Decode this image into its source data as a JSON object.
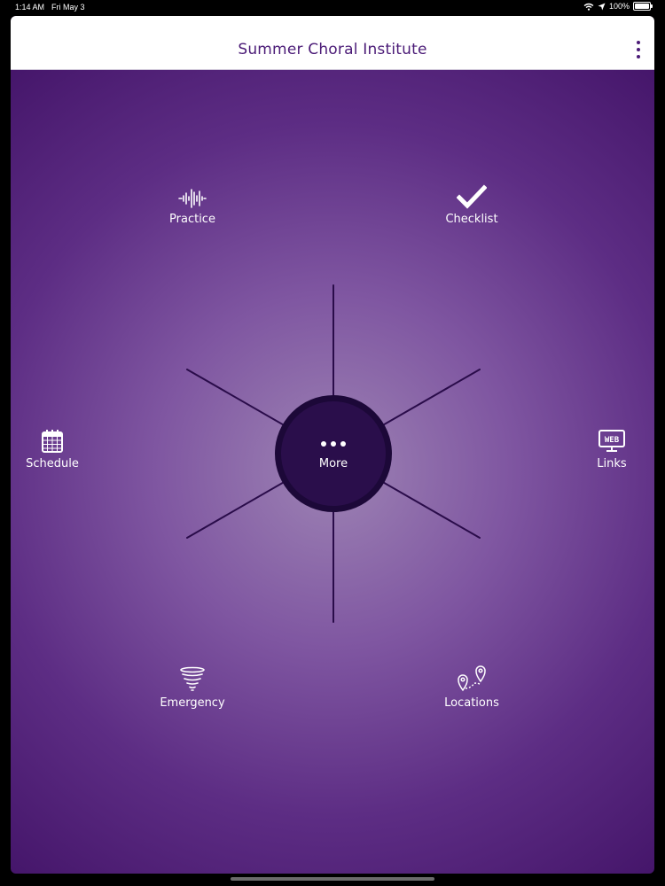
{
  "status_bar": {
    "time": "1:14 AM",
    "date": "Fri May 3",
    "battery": "100%"
  },
  "header": {
    "title": "Summer Choral Institute"
  },
  "hub": {
    "label": "More"
  },
  "nodes": {
    "practice": "Practice",
    "checklist": "Checklist",
    "schedule": "Schedule",
    "links": "Links",
    "emergency": "Emergency",
    "locations": "Locations"
  },
  "icons": {
    "practice": "sound-wave-icon",
    "checklist": "checkmark-icon",
    "schedule": "calendar-icon",
    "links": "web-monitor-icon",
    "emergency": "tornado-icon",
    "locations": "map-pins-icon"
  },
  "colors": {
    "accent": "#4b1b77",
    "hub": "#2a0e4b",
    "background": "#5d2d84"
  }
}
